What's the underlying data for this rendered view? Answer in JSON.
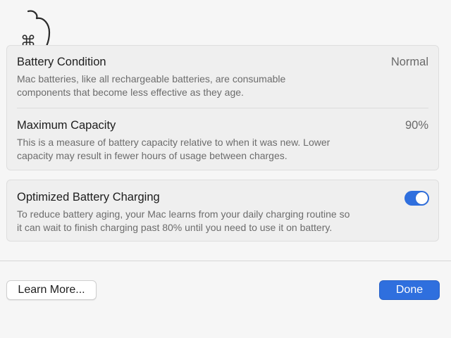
{
  "battery_condition": {
    "title": "Battery Condition",
    "value": "Normal",
    "description_line1": "Mac batteries, like all rechargeable batteries, are consumable",
    "description_line2": "components that become less effective as they age."
  },
  "maximum_capacity": {
    "title": "Maximum Capacity",
    "value": "90%",
    "description_line1": "This is a measure of battery capacity relative to when it was new. Lower",
    "description_line2": "capacity may result in fewer hours of usage between charges."
  },
  "optimized_charging": {
    "title": "Optimized Battery Charging",
    "enabled": true,
    "description_line1": "To reduce battery aging, your Mac learns from your daily charging routine so",
    "description_line2": "it can wait to finish charging past 80% until you need to use it on battery."
  },
  "buttons": {
    "learn_more": "Learn More...",
    "done": "Done"
  },
  "colors": {
    "accent": "#2f6fde",
    "background": "#f6f6f6",
    "panel": "#efefef"
  },
  "icons": {
    "logo": "apple-command-logo-icon"
  }
}
